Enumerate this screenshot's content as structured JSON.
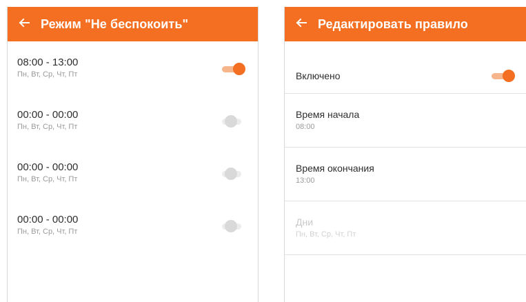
{
  "colors": {
    "accent": "#f46f22",
    "accent_light": "#f7b58c",
    "text": "#2e2e2e",
    "subtext": "#9a9a9a"
  },
  "left_screen": {
    "title": "Режим \"Не беспокоить\"",
    "back_icon": "arrow-left-icon",
    "rules": [
      {
        "time": "08:00 - 13:00",
        "days": "Пн, Вт, Ср, Чт, Пт",
        "enabled": true
      },
      {
        "time": "00:00 - 00:00",
        "days": "Пн, Вт, Ср, Чт, Пт",
        "enabled": false
      },
      {
        "time": "00:00 - 00:00",
        "days": "Пн, Вт, Ср, Чт, Пт",
        "enabled": false
      },
      {
        "time": "00:00 - 00:00",
        "days": "Пн, Вт, Ср, Чт, Пт",
        "enabled": false
      }
    ]
  },
  "right_screen": {
    "title": "Редактировать правило",
    "back_icon": "arrow-left-icon",
    "enabled_label": "Включено",
    "enabled": true,
    "start_label": "Время начала",
    "start_value": "08:00",
    "end_label": "Время окончания",
    "end_value": "13:00",
    "days_label": "Дни",
    "days_value": "Пн, Вт, Ср, Чт, Пт"
  }
}
